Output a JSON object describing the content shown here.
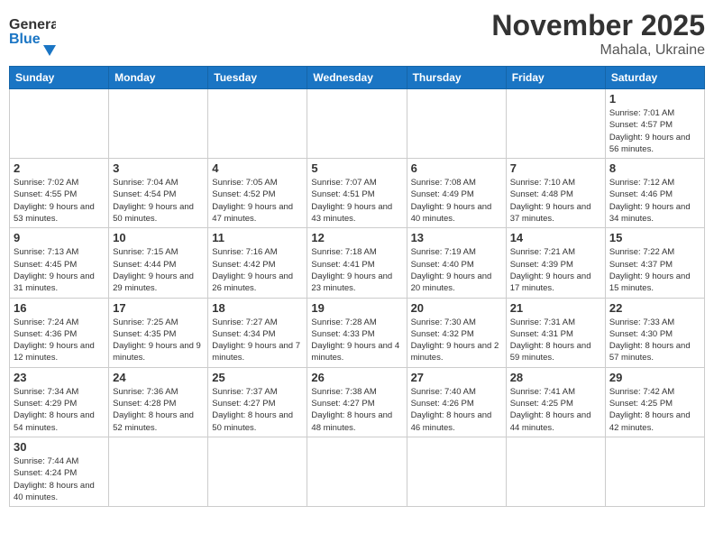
{
  "header": {
    "logo_general": "General",
    "logo_blue": "Blue",
    "month": "November 2025",
    "location": "Mahala, Ukraine"
  },
  "weekdays": [
    "Sunday",
    "Monday",
    "Tuesday",
    "Wednesday",
    "Thursday",
    "Friday",
    "Saturday"
  ],
  "weeks": [
    [
      null,
      null,
      null,
      null,
      null,
      null,
      {
        "day": "1",
        "sunrise": "Sunrise: 7:01 AM",
        "sunset": "Sunset: 4:57 PM",
        "daylight": "Daylight: 9 hours and 56 minutes."
      }
    ],
    [
      {
        "day": "2",
        "sunrise": "Sunrise: 7:02 AM",
        "sunset": "Sunset: 4:55 PM",
        "daylight": "Daylight: 9 hours and 53 minutes."
      },
      {
        "day": "3",
        "sunrise": "Sunrise: 7:04 AM",
        "sunset": "Sunset: 4:54 PM",
        "daylight": "Daylight: 9 hours and 50 minutes."
      },
      {
        "day": "4",
        "sunrise": "Sunrise: 7:05 AM",
        "sunset": "Sunset: 4:52 PM",
        "daylight": "Daylight: 9 hours and 47 minutes."
      },
      {
        "day": "5",
        "sunrise": "Sunrise: 7:07 AM",
        "sunset": "Sunset: 4:51 PM",
        "daylight": "Daylight: 9 hours and 43 minutes."
      },
      {
        "day": "6",
        "sunrise": "Sunrise: 7:08 AM",
        "sunset": "Sunset: 4:49 PM",
        "daylight": "Daylight: 9 hours and 40 minutes."
      },
      {
        "day": "7",
        "sunrise": "Sunrise: 7:10 AM",
        "sunset": "Sunset: 4:48 PM",
        "daylight": "Daylight: 9 hours and 37 minutes."
      },
      {
        "day": "8",
        "sunrise": "Sunrise: 7:12 AM",
        "sunset": "Sunset: 4:46 PM",
        "daylight": "Daylight: 9 hours and 34 minutes."
      }
    ],
    [
      {
        "day": "9",
        "sunrise": "Sunrise: 7:13 AM",
        "sunset": "Sunset: 4:45 PM",
        "daylight": "Daylight: 9 hours and 31 minutes."
      },
      {
        "day": "10",
        "sunrise": "Sunrise: 7:15 AM",
        "sunset": "Sunset: 4:44 PM",
        "daylight": "Daylight: 9 hours and 29 minutes."
      },
      {
        "day": "11",
        "sunrise": "Sunrise: 7:16 AM",
        "sunset": "Sunset: 4:42 PM",
        "daylight": "Daylight: 9 hours and 26 minutes."
      },
      {
        "day": "12",
        "sunrise": "Sunrise: 7:18 AM",
        "sunset": "Sunset: 4:41 PM",
        "daylight": "Daylight: 9 hours and 23 minutes."
      },
      {
        "day": "13",
        "sunrise": "Sunrise: 7:19 AM",
        "sunset": "Sunset: 4:40 PM",
        "daylight": "Daylight: 9 hours and 20 minutes."
      },
      {
        "day": "14",
        "sunrise": "Sunrise: 7:21 AM",
        "sunset": "Sunset: 4:39 PM",
        "daylight": "Daylight: 9 hours and 17 minutes."
      },
      {
        "day": "15",
        "sunrise": "Sunrise: 7:22 AM",
        "sunset": "Sunset: 4:37 PM",
        "daylight": "Daylight: 9 hours and 15 minutes."
      }
    ],
    [
      {
        "day": "16",
        "sunrise": "Sunrise: 7:24 AM",
        "sunset": "Sunset: 4:36 PM",
        "daylight": "Daylight: 9 hours and 12 minutes."
      },
      {
        "day": "17",
        "sunrise": "Sunrise: 7:25 AM",
        "sunset": "Sunset: 4:35 PM",
        "daylight": "Daylight: 9 hours and 9 minutes."
      },
      {
        "day": "18",
        "sunrise": "Sunrise: 7:27 AM",
        "sunset": "Sunset: 4:34 PM",
        "daylight": "Daylight: 9 hours and 7 minutes."
      },
      {
        "day": "19",
        "sunrise": "Sunrise: 7:28 AM",
        "sunset": "Sunset: 4:33 PM",
        "daylight": "Daylight: 9 hours and 4 minutes."
      },
      {
        "day": "20",
        "sunrise": "Sunrise: 7:30 AM",
        "sunset": "Sunset: 4:32 PM",
        "daylight": "Daylight: 9 hours and 2 minutes."
      },
      {
        "day": "21",
        "sunrise": "Sunrise: 7:31 AM",
        "sunset": "Sunset: 4:31 PM",
        "daylight": "Daylight: 8 hours and 59 minutes."
      },
      {
        "day": "22",
        "sunrise": "Sunrise: 7:33 AM",
        "sunset": "Sunset: 4:30 PM",
        "daylight": "Daylight: 8 hours and 57 minutes."
      }
    ],
    [
      {
        "day": "23",
        "sunrise": "Sunrise: 7:34 AM",
        "sunset": "Sunset: 4:29 PM",
        "daylight": "Daylight: 8 hours and 54 minutes."
      },
      {
        "day": "24",
        "sunrise": "Sunrise: 7:36 AM",
        "sunset": "Sunset: 4:28 PM",
        "daylight": "Daylight: 8 hours and 52 minutes."
      },
      {
        "day": "25",
        "sunrise": "Sunrise: 7:37 AM",
        "sunset": "Sunset: 4:27 PM",
        "daylight": "Daylight: 8 hours and 50 minutes."
      },
      {
        "day": "26",
        "sunrise": "Sunrise: 7:38 AM",
        "sunset": "Sunset: 4:27 PM",
        "daylight": "Daylight: 8 hours and 48 minutes."
      },
      {
        "day": "27",
        "sunrise": "Sunrise: 7:40 AM",
        "sunset": "Sunset: 4:26 PM",
        "daylight": "Daylight: 8 hours and 46 minutes."
      },
      {
        "day": "28",
        "sunrise": "Sunrise: 7:41 AM",
        "sunset": "Sunset: 4:25 PM",
        "daylight": "Daylight: 8 hours and 44 minutes."
      },
      {
        "day": "29",
        "sunrise": "Sunrise: 7:42 AM",
        "sunset": "Sunset: 4:25 PM",
        "daylight": "Daylight: 8 hours and 42 minutes."
      }
    ],
    [
      {
        "day": "30",
        "sunrise": "Sunrise: 7:44 AM",
        "sunset": "Sunset: 4:24 PM",
        "daylight": "Daylight: 8 hours and 40 minutes."
      },
      null,
      null,
      null,
      null,
      null,
      null
    ]
  ]
}
